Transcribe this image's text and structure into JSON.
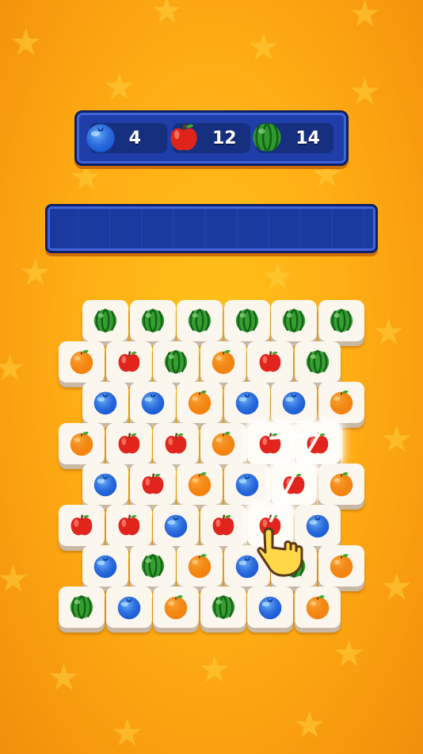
{
  "goals": [
    {
      "fruit": "blueberry",
      "count": "4"
    },
    {
      "fruit": "apple",
      "count": "12"
    },
    {
      "fruit": "watermelon",
      "count": "14"
    }
  ],
  "tray": {
    "slots": []
  },
  "board": {
    "rows": [
      [
        "watermelon",
        "watermelon",
        "watermelon",
        "watermelon",
        "watermelon",
        "watermelon"
      ],
      [
        "orange",
        "apple",
        "watermelon",
        "orange",
        "apple",
        "watermelon"
      ],
      [
        "blueberry",
        "blueberry",
        "orange",
        "blueberry",
        "blueberry",
        "orange"
      ],
      [
        "orange",
        "apple",
        "apple",
        "orange",
        "apple",
        "apple"
      ],
      [
        "blueberry",
        "apple",
        "orange",
        "blueberry",
        "apple",
        "orange"
      ],
      [
        "apple",
        "apple",
        "blueberry",
        "apple",
        "apple",
        "blueberry"
      ],
      [
        "blueberry",
        "watermelon",
        "orange",
        "blueberry",
        "watermelon",
        "orange"
      ],
      [
        "watermelon",
        "blueberry",
        "orange",
        "watermelon",
        "blueberry",
        "orange"
      ]
    ],
    "selected": [
      [
        3,
        4
      ],
      [
        3,
        5
      ],
      [
        4,
        4
      ],
      [
        5,
        4
      ]
    ]
  },
  "colors": {
    "background": "#ffae14",
    "panel": "#1f3ea9",
    "tile": "#fbf6ee"
  },
  "tutorial": {
    "icon": "pointing-hand-icon"
  }
}
